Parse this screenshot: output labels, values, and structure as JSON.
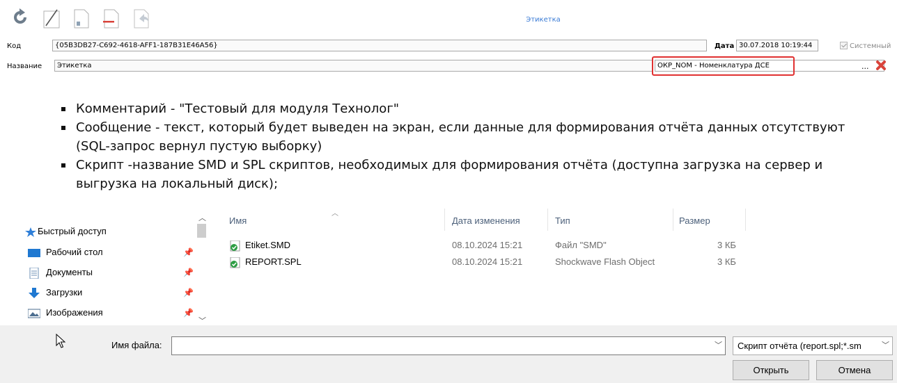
{
  "form": {
    "title": "Этикетка",
    "code_label": "Код",
    "code_value": "{05B3DB27-C692-4618-AFF1-187B31E46A56}",
    "date_label": "Дата",
    "date_value": "30.07.2018 10:19:44",
    "system_label": "Системный",
    "name_label": "Название",
    "name_value": "Этикетка",
    "nomenclature_value": "ОКР_NOM - Номенклатура ДСЕ",
    "ellipsis": "..."
  },
  "toolbar": {
    "icons": [
      "refresh-icon",
      "edit-icon",
      "save-icon",
      "delete-icon",
      "undo-icon"
    ]
  },
  "bullets": [
    "Комментарий - \"Тестовый для модуля Технолог\"",
    "Сообщение - текст, который будет выведен на экран, если данные для формирования отчёта данных отсутствуют (SQL-запрос вернул пустую выборку)",
    "Скрипт  -название SMD и SPL скриптов, необходимых для формирования отчёта (доступна загрузка на сервер и выгрузка на локальный диск);"
  ],
  "dialog": {
    "nav": {
      "quick_access": "Быстрый доступ",
      "items": [
        "Рабочий стол",
        "Документы",
        "Загрузки",
        "Изображения"
      ]
    },
    "columns": {
      "name": "Имя",
      "date": "Дата изменения",
      "type": "Тип",
      "size": "Размер"
    },
    "files": [
      {
        "name": "Etiket.SMD",
        "date": "08.10.2024 15:21",
        "type": "Файл \"SMD\"",
        "size": "3 КБ"
      },
      {
        "name": "REPORT.SPL",
        "date": "08.10.2024 15:21",
        "type": "Shockwave Flash Object",
        "size": "3 КБ"
      }
    ],
    "filename_label": "Имя файла:",
    "filename_value": "",
    "filter_value": "Скрипт отчёта (report.spl;*.sm",
    "open_label": "Открыть",
    "cancel_label": "Отмена"
  },
  "colors": {
    "accent": "#3a7bd5",
    "highlight": "#e03131",
    "delete": "#d9433a"
  }
}
